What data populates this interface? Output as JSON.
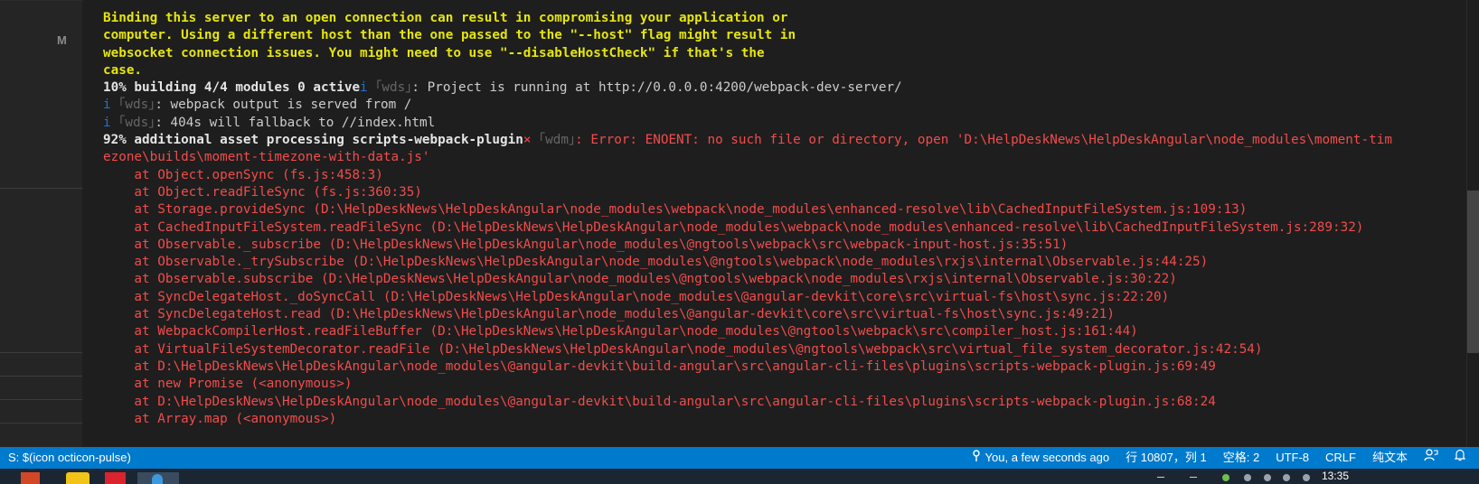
{
  "sidebar": {
    "letter": "M"
  },
  "terminal": {
    "lines": [
      [
        {
          "c": "y",
          "t": "Binding this server to an open connection can result in compromising your application or"
        }
      ],
      [
        {
          "c": "y",
          "t": "computer. Using a different host than the one passed to the \"--host\" flag might result in"
        }
      ],
      [
        {
          "c": "y",
          "t": "websocket connection issues. You might need to use \"--disableHostCheck\" if that's the"
        }
      ],
      [
        {
          "c": "y",
          "t": "case."
        }
      ],
      [
        {
          "c": "wb",
          "t": "10% building 4/4 modules 0 active"
        },
        {
          "c": "b",
          "t": "i "
        },
        {
          "c": "g",
          "t": "｢wds｣"
        },
        {
          "c": "w",
          "t": ": Project is running at http://0.0.0.0:4200/webpack-dev-server/"
        }
      ],
      [
        {
          "c": "b",
          "t": "i "
        },
        {
          "c": "g",
          "t": "｢wds｣"
        },
        {
          "c": "w",
          "t": ": webpack output is served from /"
        }
      ],
      [
        {
          "c": "b",
          "t": "i "
        },
        {
          "c": "g",
          "t": "｢wds｣"
        },
        {
          "c": "w",
          "t": ": 404s will fallback to //index.html"
        }
      ],
      [
        {
          "c": "wb",
          "t": "92% additional asset processing scripts-webpack-plugin"
        },
        {
          "c": "r",
          "t": "× "
        },
        {
          "c": "g",
          "t": "｢wdm｣"
        },
        {
          "c": "r",
          "t": ": Error: ENOENT: no such file or directory, open 'D:\\HelpDeskNews\\HelpDeskAngular\\node_modules\\moment-tim"
        }
      ],
      [
        {
          "c": "r",
          "t": "ezone\\builds\\moment-timezone-with-data.js'"
        }
      ],
      [
        {
          "c": "r",
          "t": "    at Object.openSync (fs.js:458:3)"
        }
      ],
      [
        {
          "c": "r",
          "t": "    at Object.readFileSync (fs.js:360:35)"
        }
      ],
      [
        {
          "c": "r",
          "t": "    at Storage.provideSync (D:\\HelpDeskNews\\HelpDeskAngular\\node_modules\\webpack\\node_modules\\enhanced-resolve\\lib\\CachedInputFileSystem.js:109:13)"
        }
      ],
      [
        {
          "c": "r",
          "t": "    at CachedInputFileSystem.readFileSync (D:\\HelpDeskNews\\HelpDeskAngular\\node_modules\\webpack\\node_modules\\enhanced-resolve\\lib\\CachedInputFileSystem.js:289:32)"
        }
      ],
      [
        {
          "c": "r",
          "t": "    at Observable._subscribe (D:\\HelpDeskNews\\HelpDeskAngular\\node_modules\\@ngtools\\webpack\\src\\webpack-input-host.js:35:51)"
        }
      ],
      [
        {
          "c": "r",
          "t": "    at Observable._trySubscribe (D:\\HelpDeskNews\\HelpDeskAngular\\node_modules\\@ngtools\\webpack\\node_modules\\rxjs\\internal\\Observable.js:44:25)"
        }
      ],
      [
        {
          "c": "r",
          "t": "    at Observable.subscribe (D:\\HelpDeskNews\\HelpDeskAngular\\node_modules\\@ngtools\\webpack\\node_modules\\rxjs\\internal\\Observable.js:30:22)"
        }
      ],
      [
        {
          "c": "r",
          "t": "    at SyncDelegateHost._doSyncCall (D:\\HelpDeskNews\\HelpDeskAngular\\node_modules\\@angular-devkit\\core\\src\\virtual-fs\\host\\sync.js:22:20)"
        }
      ],
      [
        {
          "c": "r",
          "t": "    at SyncDelegateHost.read (D:\\HelpDeskNews\\HelpDeskAngular\\node_modules\\@angular-devkit\\core\\src\\virtual-fs\\host\\sync.js:49:21)"
        }
      ],
      [
        {
          "c": "r",
          "t": "    at WebpackCompilerHost.readFileBuffer (D:\\HelpDeskNews\\HelpDeskAngular\\node_modules\\@ngtools\\webpack\\src\\compiler_host.js:161:44)"
        }
      ],
      [
        {
          "c": "r",
          "t": "    at VirtualFileSystemDecorator.readFile (D:\\HelpDeskNews\\HelpDeskAngular\\node_modules\\@ngtools\\webpack\\src\\virtual_file_system_decorator.js:42:54)"
        }
      ],
      [
        {
          "c": "r",
          "t": "    at D:\\HelpDeskNews\\HelpDeskAngular\\node_modules\\@angular-devkit\\build-angular\\src\\angular-cli-files\\plugins\\scripts-webpack-plugin.js:69:49"
        }
      ],
      [
        {
          "c": "r",
          "t": "    at new Promise (<anonymous>)"
        }
      ],
      [
        {
          "c": "r",
          "t": "    at D:\\HelpDeskNews\\HelpDeskAngular\\node_modules\\@angular-devkit\\build-angular\\src\\angular-cli-files\\plugins\\scripts-webpack-plugin.js:68:24"
        }
      ],
      [
        {
          "c": "r",
          "t": "    at Array.map (<anonymous>)"
        }
      ]
    ]
  },
  "statusbar": {
    "left_text": "S: $(icon octicon-pulse)",
    "git_icon": "git-commit-icon",
    "blame": "You, a few seconds ago",
    "position": "行 10807，列 1",
    "spaces": "空格: 2",
    "encoding": "UTF-8",
    "eol": "CRLF",
    "language": "纯文本",
    "feedback_icon": "person-feedback-icon",
    "bell_icon": "bell-icon"
  },
  "taskbar": {
    "time": "13:35"
  },
  "colors": {
    "terminal_bg": "#1e1e1e",
    "sidebar_bg": "#252526",
    "statusbar_bg": "#007acc",
    "yellow": "#e5e510",
    "red": "#f14c4c",
    "blue": "#2472c8"
  }
}
